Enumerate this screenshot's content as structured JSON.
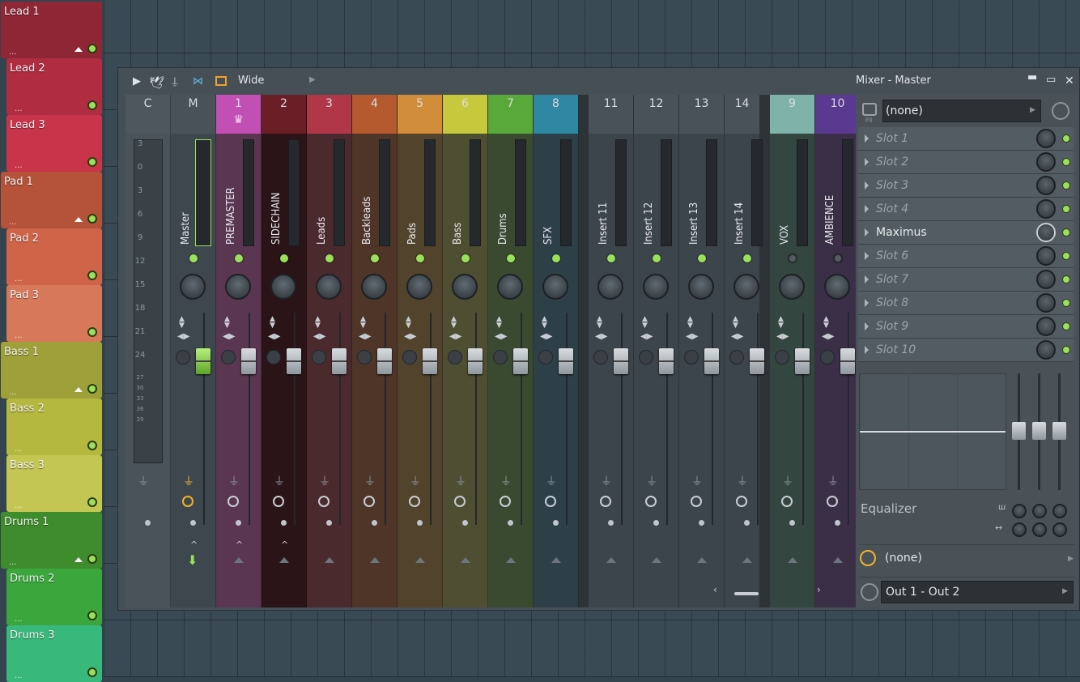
{
  "playlist": {
    "tracks": [
      {
        "name": "Lead 1",
        "color": "#8f2636",
        "head": true
      },
      {
        "name": "Lead 2",
        "color": "#b02c40",
        "head": false
      },
      {
        "name": "Lead 3",
        "color": "#c8344a",
        "head": false
      },
      {
        "name": "Pad 1",
        "color": "#b4523a",
        "head": true
      },
      {
        "name": "Pad 2",
        "color": "#cf6448",
        "head": false
      },
      {
        "name": "Pad 3",
        "color": "#d7785a",
        "head": false
      },
      {
        "name": "Bass 1",
        "color": "#9ea03a",
        "head": true
      },
      {
        "name": "Bass 2",
        "color": "#b5b83e",
        "head": false
      },
      {
        "name": "Bass 3",
        "color": "#c3c652",
        "head": false
      },
      {
        "name": "Drums 1",
        "color": "#3f8c2e",
        "head": true
      },
      {
        "name": "Drums 2",
        "color": "#3aa63c",
        "head": false
      },
      {
        "name": "Drums 3",
        "color": "#38b87a",
        "head": false
      }
    ],
    "dots": "..."
  },
  "mixer": {
    "toolbar": {
      "view_label": "Wide"
    },
    "title": "Mixer - Master",
    "window_controls": {
      "minimize": "▬",
      "maximize": "▭",
      "close": "✕"
    },
    "meter_scale": [
      "3",
      "0",
      "3",
      "6",
      "9",
      "12",
      "15",
      "18",
      "21",
      "24",
      "27",
      "30",
      "33",
      "36",
      "39"
    ],
    "strips": [
      {
        "id": "C",
        "label": "",
        "color": "#4b535a",
        "hcolor": "#4f575e",
        "led": false
      },
      {
        "id": "M",
        "label": "Master",
        "color": "#3f474e",
        "hcolor": "#4a5259",
        "led": true,
        "selected": true
      },
      {
        "id": "1",
        "label": "PREMASTER",
        "color": "#5a3650",
        "hcolor": "#c24fb4",
        "led": true,
        "crown": true
      },
      {
        "id": "2",
        "label": "SIDECHAIN",
        "color": "#2a1418",
        "hcolor": "#6a1e26",
        "led": true
      },
      {
        "id": "3",
        "label": "Leads",
        "color": "#4b2a2e",
        "hcolor": "#b03748",
        "led": true
      },
      {
        "id": "4",
        "label": "Backleads",
        "color": "#4e3528",
        "hcolor": "#b55a2e",
        "led": true
      },
      {
        "id": "5",
        "label": "Pads",
        "color": "#52432c",
        "hcolor": "#d18d3a",
        "led": true
      },
      {
        "id": "6",
        "label": "Bass",
        "color": "#4d4e32",
        "hcolor": "#c8c83c",
        "led": true
      },
      {
        "id": "7",
        "label": "Drums",
        "color": "#3a4a30",
        "hcolor": "#58a83a",
        "led": true
      },
      {
        "id": "8",
        "label": "SFX",
        "color": "#2d4048",
        "hcolor": "#2f87a3",
        "led": true
      },
      {
        "id": "11",
        "label": "Insert 11",
        "color": "#3d454c",
        "hcolor": "#4a5259",
        "led": true
      },
      {
        "id": "12",
        "label": "Insert 12",
        "color": "#3d454c",
        "hcolor": "#4a5259",
        "led": true
      },
      {
        "id": "13",
        "label": "Insert 13",
        "color": "#3d454c",
        "hcolor": "#4a5259",
        "led": true
      },
      {
        "id": "14",
        "label": "Insert 14",
        "color": "#3d454c",
        "hcolor": "#4a5259",
        "led": true
      },
      {
        "id": "9",
        "label": "VOX",
        "color": "#33463f",
        "hcolor": "#7fb3aa",
        "led": false
      },
      {
        "id": "10",
        "label": "AMBIENCE",
        "color": "#3b2f48",
        "hcolor": "#5a3990",
        "led": false
      }
    ],
    "panel": {
      "input_select": "(none)",
      "eq_icon_label": "EQ",
      "slots": [
        {
          "name": "Slot 1",
          "active": false
        },
        {
          "name": "Slot 2",
          "active": false
        },
        {
          "name": "Slot 3",
          "active": false
        },
        {
          "name": "Slot 4",
          "active": false
        },
        {
          "name": "Maximus",
          "active": true
        },
        {
          "name": "Slot 6",
          "active": false
        },
        {
          "name": "Slot 7",
          "active": false
        },
        {
          "name": "Slot 8",
          "active": false
        },
        {
          "name": "Slot 9",
          "active": false
        },
        {
          "name": "Slot 10",
          "active": false
        }
      ],
      "equalizer_label": "Equalizer",
      "eq_band_icon": "ш",
      "eq_width_icon": "↔",
      "sidechain_select": "(none)",
      "output_select": "Out 1 - Out 2"
    }
  }
}
